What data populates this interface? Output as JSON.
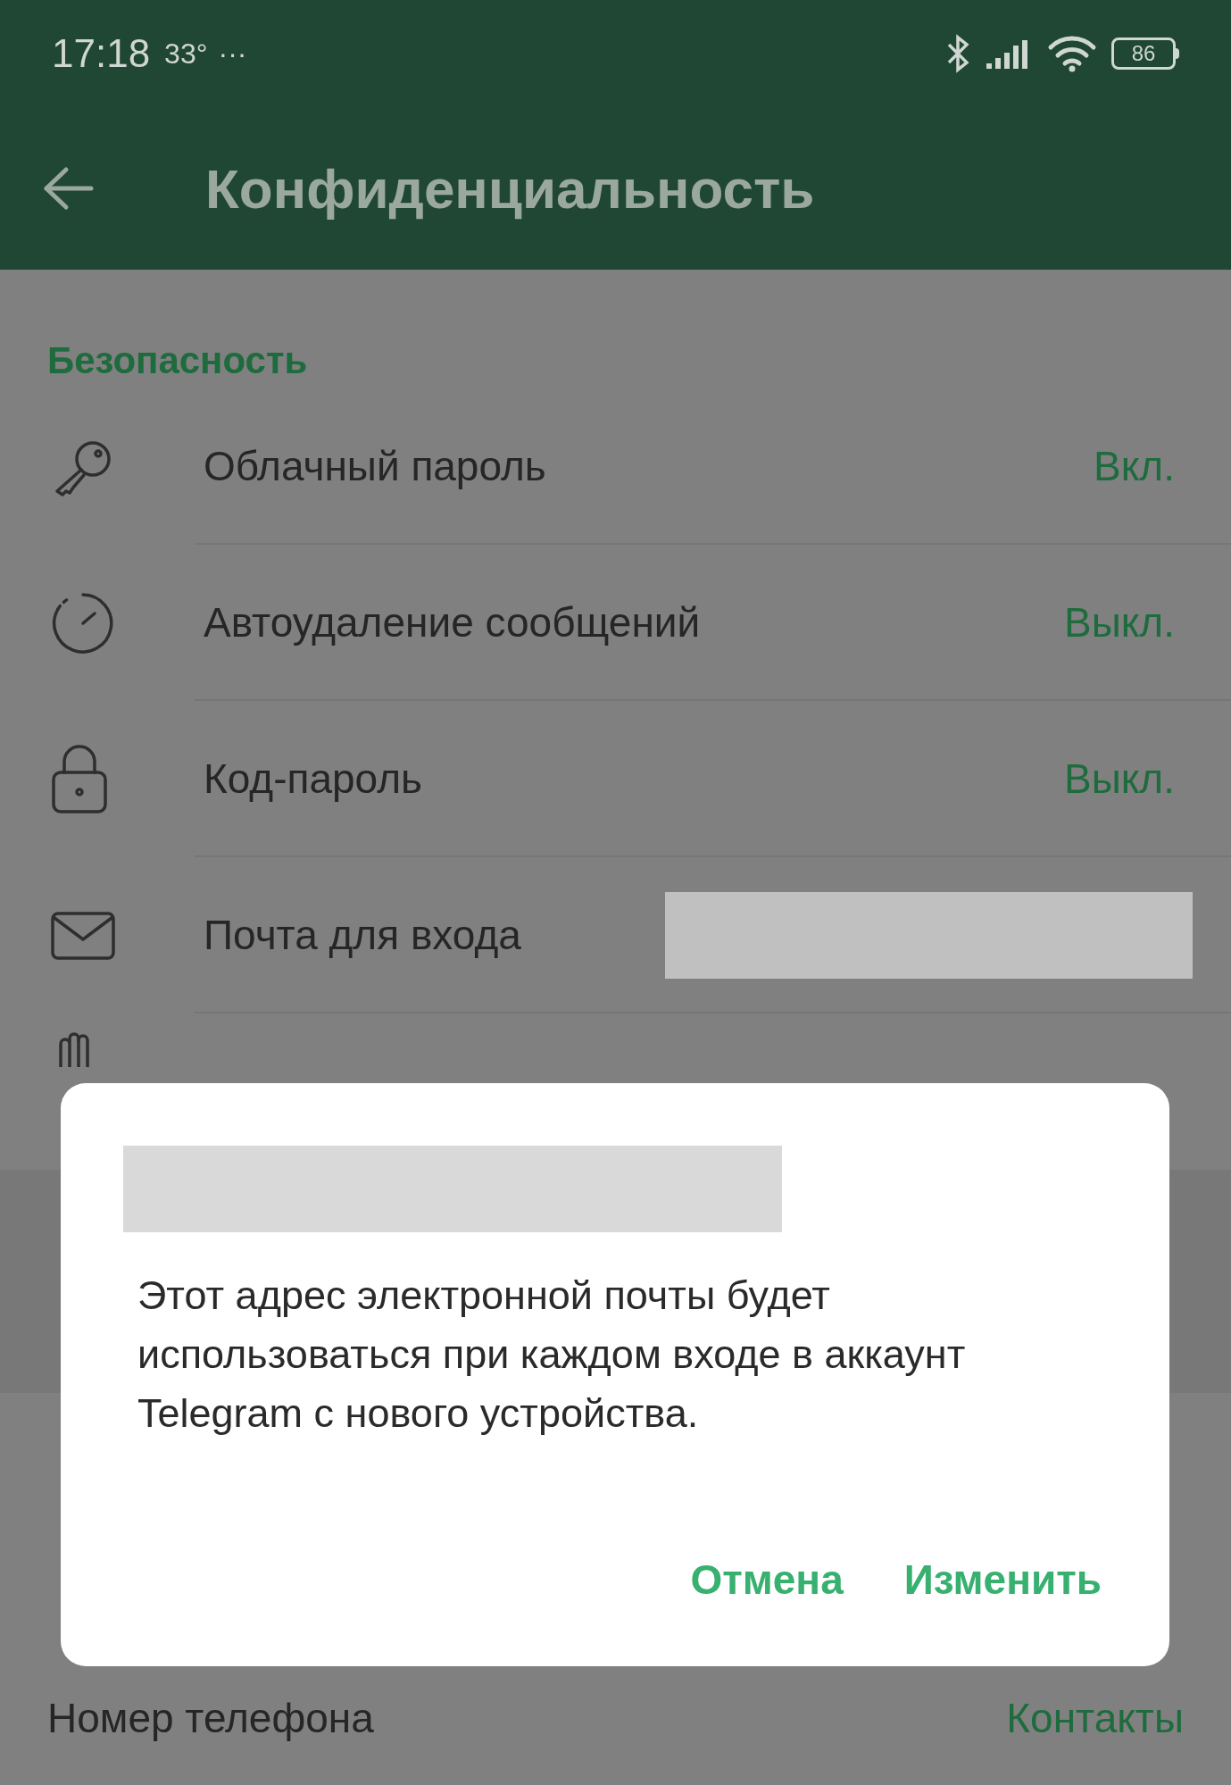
{
  "status_bar": {
    "time": "17:18",
    "temperature": "33°",
    "more": "···",
    "battery": "86"
  },
  "app_bar": {
    "title": "Конфиденциальность"
  },
  "section": {
    "title": "Безопасность"
  },
  "rows": [
    {
      "kind": "key",
      "label": "Облачный пароль",
      "value": "Вкл."
    },
    {
      "kind": "timer",
      "label": "Автоудаление сообщений",
      "value": "Выкл."
    },
    {
      "kind": "lock",
      "label": "Код-пароль",
      "value": "Выкл."
    },
    {
      "kind": "mail",
      "label": "Почта для входа"
    }
  ],
  "dialog": {
    "message": "Этот адрес электронной почты будет использоваться при каждом входе в аккаунт Telegram с нового устройства.",
    "buttons": [
      "Отмена",
      "Изменить"
    ]
  },
  "bottom_row": {
    "label": "Номер телефона",
    "value": "Контакты"
  }
}
